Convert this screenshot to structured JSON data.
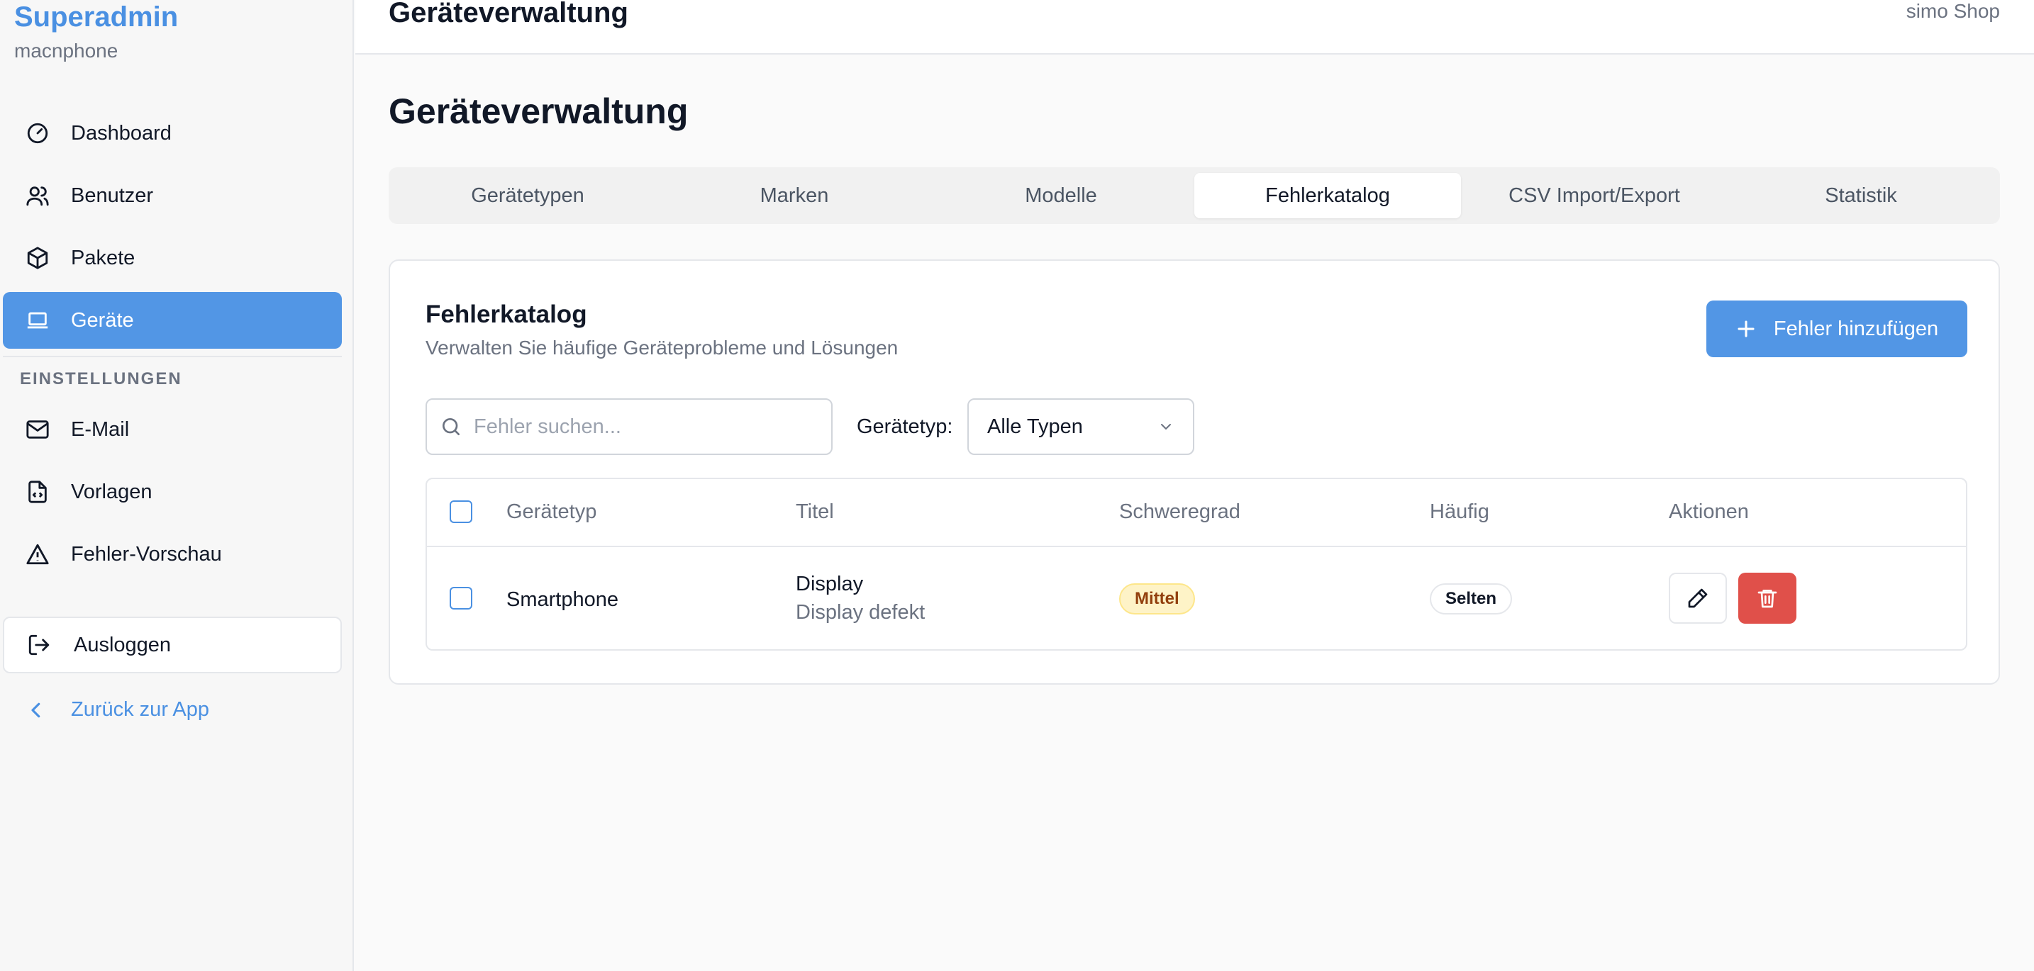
{
  "sidebar": {
    "brand": "Superadmin",
    "tenant": "macnphone",
    "items": [
      {
        "label": "Dashboard",
        "icon": "gauge-icon"
      },
      {
        "label": "Benutzer",
        "icon": "users-icon"
      },
      {
        "label": "Pakete",
        "icon": "package-icon"
      },
      {
        "label": "Geräte",
        "icon": "laptop-icon",
        "active": true
      }
    ],
    "settings_label": "EINSTELLUNGEN",
    "settings_items": [
      {
        "label": "E-Mail",
        "icon": "mail-icon"
      },
      {
        "label": "Vorlagen",
        "icon": "file-code-icon"
      },
      {
        "label": "Fehler-Vorschau",
        "icon": "warning-icon"
      }
    ],
    "logout_label": "Ausloggen",
    "back_label": "Zurück zur App"
  },
  "topbar": {
    "title": "Geräteverwaltung",
    "user": "simo Shop"
  },
  "main": {
    "page_title": "Geräteverwaltung",
    "tabs": [
      {
        "label": "Gerätetypen"
      },
      {
        "label": "Marken"
      },
      {
        "label": "Modelle"
      },
      {
        "label": "Fehlerkatalog",
        "active": true
      },
      {
        "label": "CSV Import/Export"
      },
      {
        "label": "Statistik"
      }
    ],
    "card": {
      "title": "Fehlerkatalog",
      "subtitle": "Verwalten Sie häufige Geräteprobleme und Lösungen",
      "add_button": "Fehler hinzufügen",
      "search_placeholder": "Fehler suchen...",
      "search_value": "",
      "filter_label": "Gerätetyp:",
      "filter_value": "Alle Typen",
      "table": {
        "columns": [
          "Gerätetyp",
          "Titel",
          "Schweregrad",
          "Häufig",
          "Aktionen"
        ],
        "rows": [
          {
            "device_type": "Smartphone",
            "title": "Display",
            "description": "Display defekt",
            "severity": "Mittel",
            "frequency": "Selten"
          }
        ]
      }
    }
  },
  "colors": {
    "accent": "#5296e5",
    "brand_text": "#4a90e2",
    "danger": "#e0504a",
    "severity_medium_bg": "#fef3c7"
  }
}
